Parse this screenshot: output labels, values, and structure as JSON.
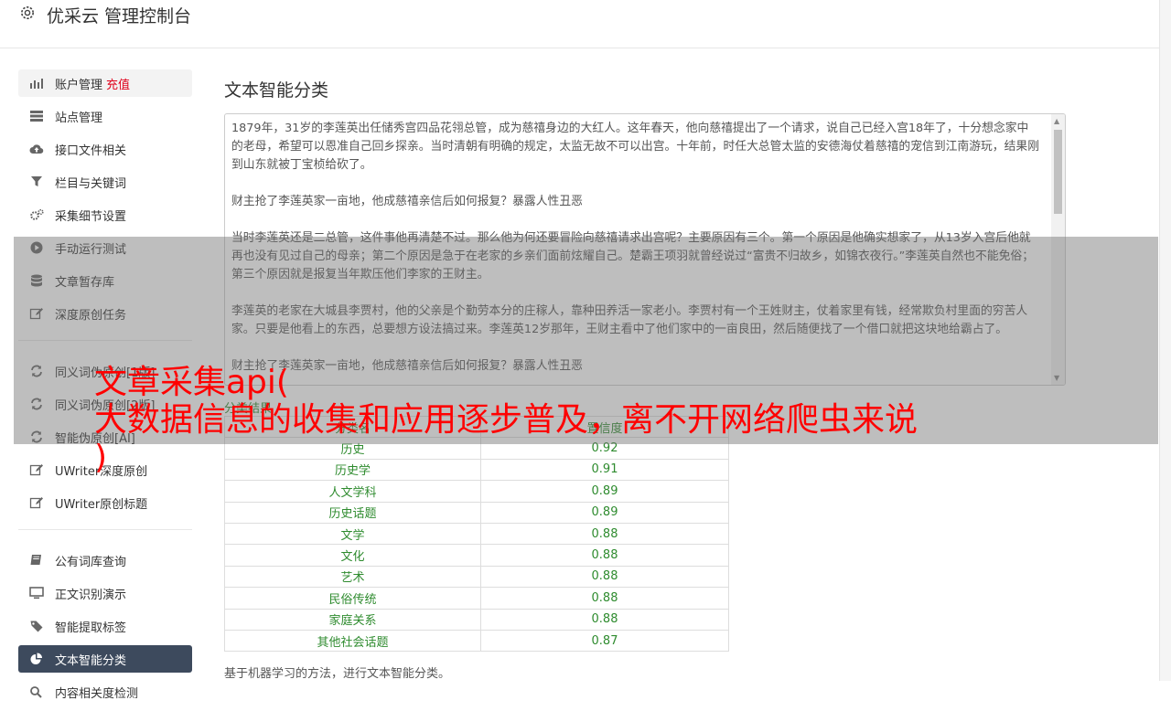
{
  "app": {
    "title": "优采云 管理控制台"
  },
  "sidebar": {
    "recharge_label": "充值",
    "group1": [
      {
        "label": "账户管理",
        "icon": "bar-chart-icon"
      },
      {
        "label": "站点管理",
        "icon": "server-icon"
      },
      {
        "label": "接口文件相关",
        "icon": "cloud-upload-icon"
      },
      {
        "label": "栏目与关键词",
        "icon": "filter-icon"
      },
      {
        "label": "采集细节设置",
        "icon": "gears-icon"
      },
      {
        "label": "手动运行测试",
        "icon": "play-icon"
      },
      {
        "label": "文章暂存库",
        "icon": "database-icon"
      },
      {
        "label": "深度原创任务",
        "icon": "edit-icon"
      }
    ],
    "group2": [
      {
        "label": "同义词伪原创[1版]",
        "icon": "refresh-icon"
      },
      {
        "label": "同义词伪原创[2版]",
        "icon": "refresh-icon"
      },
      {
        "label": "智能伪原创[AI]",
        "icon": "refresh-icon"
      },
      {
        "label": "UWriter深度原创",
        "icon": "edit-icon"
      },
      {
        "label": "UWriter原创标题",
        "icon": "edit-icon"
      }
    ],
    "group3": [
      {
        "label": "公有词库查询",
        "icon": "book-icon"
      },
      {
        "label": "正文识别演示",
        "icon": "monitor-icon"
      },
      {
        "label": "智能提取标签",
        "icon": "tag-icon"
      },
      {
        "label": "文本智能分类",
        "icon": "pie-chart-icon"
      },
      {
        "label": "内容相关度检测",
        "icon": "search-icon"
      }
    ]
  },
  "main": {
    "title": "文本智能分类",
    "input_paragraphs": [
      "1879年，31岁的李莲英出任储秀宫四品花翎总管，成为慈禧身边的大红人。这年春天，他向慈禧提出了一个请求，说自己已经入宫18年了，十分想念家中的老母，希望可以恩准自己回乡探亲。当时清朝有明确的规定，太监无故不可以出宫。十年前，时任大总管太监的安德海仗着慈禧的宠信到江南游玩，结果刚到山东就被丁宝桢给砍了。",
      "财主抢了李莲英家一亩地，他成慈禧亲信后如何报复？暴露人性丑恶",
      "当时李莲英还是二总管，这件事他再清楚不过。那么他为何还要冒险向慈禧请求出宫呢？主要原因有三个。第一个原因是他确实想家了，从13岁入宫后他就再也没有见过自己的母亲；第二个原因是急于在老家的乡亲们面前炫耀自己。楚霸王项羽就曾经说过“富贵不归故乡，如锦衣夜行。”李莲英自然也不能免俗；第三个原因就是报复当年欺压他们李家的王财主。",
      "李莲英的老家在大城县李贾村，他的父亲是个勤劳本分的庄稼人，靠种田养活一家老小。李贾村有一个王姓财主，仗着家里有钱，经常欺负村里面的穷苦人家。只要是他看上的东西，总要想方设法搞过来。李莲英12岁那年，王财主看中了他们家中的一亩良田，然后随便找了一个借口就把这块地给霸占了。",
      "财主抢了李莲英家一亩地，他成慈禧亲信后如何报复？暴露人性丑恶"
    ],
    "result_label": "分类结果",
    "table_headers": [
      "分类名",
      "置信度"
    ],
    "results": [
      {
        "category": "历史",
        "score": "0.92"
      },
      {
        "category": "历史学",
        "score": "0.91"
      },
      {
        "category": "人文学科",
        "score": "0.89"
      },
      {
        "category": "历史话题",
        "score": "0.89"
      },
      {
        "category": "文学",
        "score": "0.88"
      },
      {
        "category": "文化",
        "score": "0.88"
      },
      {
        "category": "艺术",
        "score": "0.88"
      },
      {
        "category": "民俗传统",
        "score": "0.88"
      },
      {
        "category": "家庭关系",
        "score": "0.88"
      },
      {
        "category": "其他社会话题",
        "score": "0.87"
      }
    ],
    "description": "基于机器学习的方法，进行文本智能分类。"
  },
  "overlay": {
    "line1": "文章采集api(",
    "line2": "大数据信息的收集和应用逐步普及，离不开网络爬虫来说",
    "line3": ")"
  },
  "colors": {
    "active_nav": "#3d4a5d",
    "recharge": "#e0001a",
    "result_green": "#2e8b2e",
    "overlay_text": "#ff0000"
  }
}
